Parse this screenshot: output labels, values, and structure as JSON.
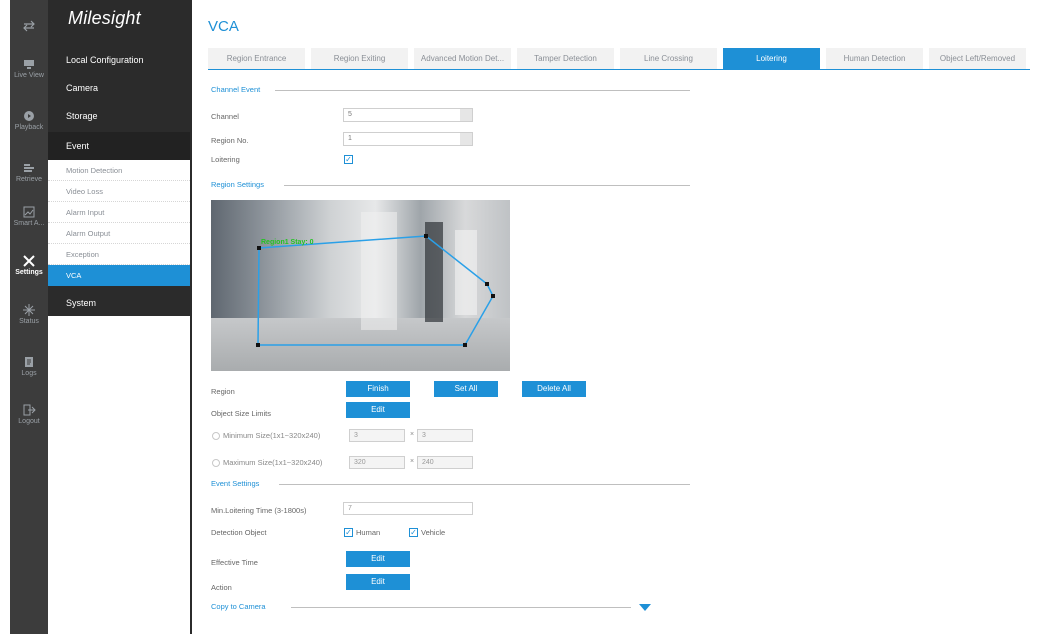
{
  "rail": [
    {
      "label": "",
      "icon": "transfer-icon"
    },
    {
      "label": "Live View",
      "icon": "monitor-icon"
    },
    {
      "label": "Playback",
      "icon": "playback-icon"
    },
    {
      "label": "Retrieve",
      "icon": "retrieve-icon"
    },
    {
      "label": "Smart A...",
      "icon": "chart-icon"
    },
    {
      "label": "Settings",
      "icon": "wrench-icon"
    },
    {
      "label": "Status",
      "icon": "status-icon"
    },
    {
      "label": "Logs",
      "icon": "logs-icon"
    },
    {
      "label": "Logout",
      "icon": "logout-icon"
    }
  ],
  "brand": "Milesight",
  "nav": {
    "top": [
      "Local Configuration",
      "Camera",
      "Storage",
      "Event"
    ],
    "event_sub": [
      "Motion Detection",
      "Video Loss",
      "Alarm Input",
      "Alarm Output",
      "Exception",
      "VCA"
    ],
    "system": "System"
  },
  "page_title": "VCA",
  "tabs": [
    "Region Entrance",
    "Region Exiting",
    "Advanced Motion Det...",
    "Tamper Detection",
    "Line Crossing",
    "Loitering",
    "Human Detection",
    "Object Left/Removed"
  ],
  "active_tab": "Loitering",
  "sections": {
    "channel_event": "Channel Event",
    "region_settings": "Region Settings",
    "event_settings": "Event Settings",
    "copy_to_camera": "Copy to Camera"
  },
  "form": {
    "channel_label": "Channel",
    "channel_value": "5",
    "region_no_label": "Region No.",
    "region_no_value": "1",
    "loitering_label": "Loitering",
    "region_label": "Region",
    "object_size_label": "Object Size Limits",
    "min_size_label": "Minimum Size(1x1~320x240)",
    "min_w": "3",
    "min_h": "3",
    "max_size_label": "Maximum Size(1x1~320x240)",
    "max_w": "320",
    "max_h": "240",
    "x_sep": "×",
    "min_loiter_label": "Min.Loitering Time (3-1800s)",
    "min_loiter_value": "7",
    "detection_object_label": "Detection Object",
    "human_label": "Human",
    "vehicle_label": "Vehicle",
    "effective_time_label": "Effective Time",
    "action_label": "Action"
  },
  "buttons": {
    "finish": "Finish",
    "set_all": "Set All",
    "delete_all": "Delete All",
    "edit": "Edit"
  },
  "overlay": {
    "region_text": "Region1 Stay: 0"
  },
  "colors": {
    "accent": "#1e90d6",
    "dark": "#2b2b2b",
    "overlay_text": "#22c322"
  }
}
